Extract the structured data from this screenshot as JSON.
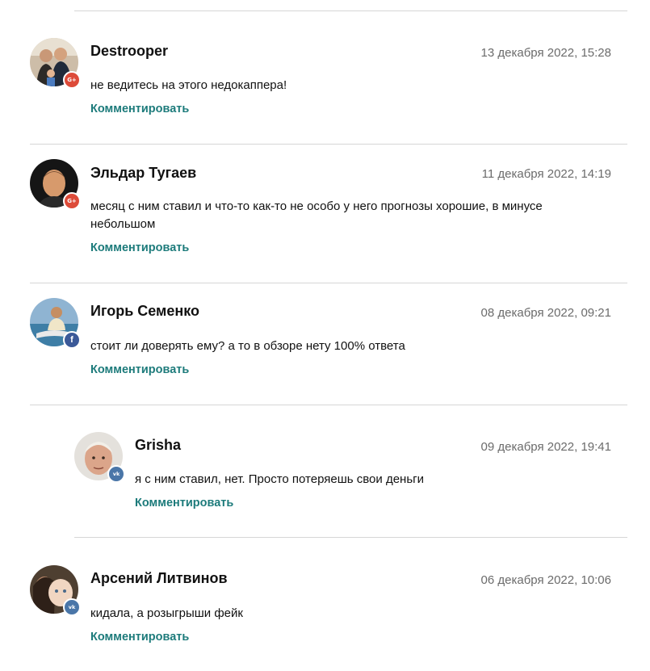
{
  "comments": [
    {
      "author": "Destrooper",
      "date": "13 декабря 2022, 15:28",
      "text": "не ведитесь на этого недокаппера!",
      "reply_label": "Комментировать",
      "network": "google-plus",
      "network_glyph": "G+",
      "avatar_colors": {
        "bg": "#c9b9a4",
        "fg": "#6b4f3a"
      }
    },
    {
      "author": "Эльдар Тугаев",
      "date": "11 декабря 2022, 14:19",
      "text": "месяц с ним ставил и что-то как-то не особо у него прогнозы хорошие, в минусе небольшом",
      "reply_label": "Комментировать",
      "network": "google-plus",
      "network_glyph": "G+",
      "avatar_colors": {
        "bg": "#1e1e1e",
        "fg": "#d9a070"
      }
    },
    {
      "author": "Игорь Семенко",
      "date": "08 декабря 2022, 09:21",
      "text": "стоит ли доверять ему? а то в обзоре нету 100% ответа",
      "reply_label": "Комментировать",
      "network": "facebook",
      "network_glyph": "f",
      "avatar_colors": {
        "bg": "#6f9cc0",
        "fg": "#e8d9b8"
      }
    },
    {
      "author": "Grisha",
      "date": "09 декабря 2022, 19:41",
      "text": "я с ним ставил, нет. Просто потеряешь свои деньги",
      "reply_label": "Комментировать",
      "network": "vkontakte",
      "network_glyph": "vk",
      "avatar_colors": {
        "bg": "#e6e2dc",
        "fg": "#d7a98c"
      }
    },
    {
      "author": "Арсений Литвинов",
      "date": "06 декабря 2022, 10:06",
      "text": "кидала, а розыгрыши фейк",
      "reply_label": "Комментировать",
      "network": "vkontakte",
      "network_glyph": "vk",
      "avatar_colors": {
        "bg": "#5a4a3a",
        "fg": "#f0d8c0"
      }
    }
  ],
  "colors": {
    "reply_link": "#1d7b7b",
    "date": "#6b6b6b",
    "divider": "#d6d6d6"
  }
}
